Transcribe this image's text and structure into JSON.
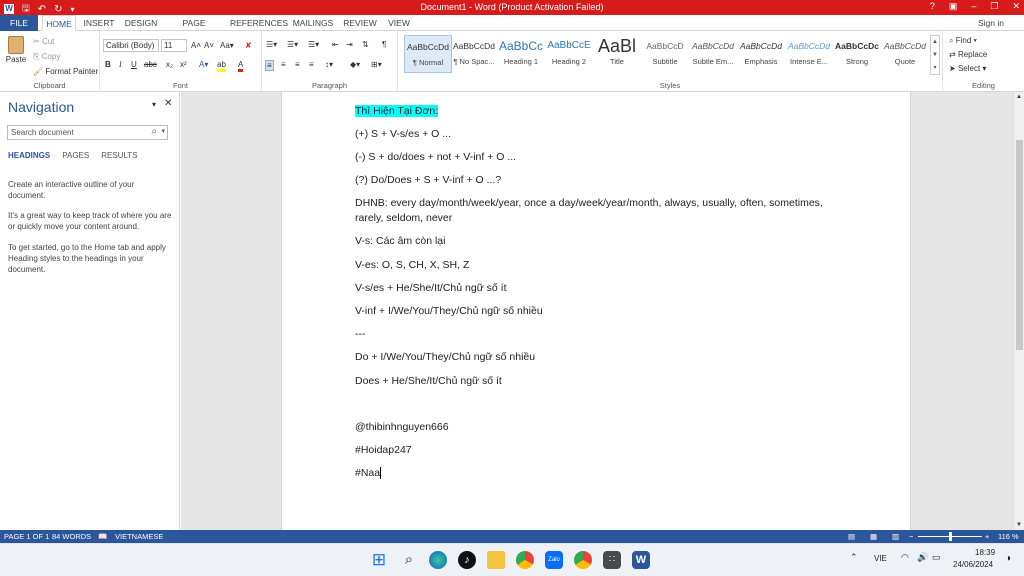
{
  "titlebar": {
    "title": "Document1 - Word (Product Activation Failed)",
    "help": "?"
  },
  "tabs": {
    "file": "FILE",
    "home": "HOME",
    "insert": "INSERT",
    "design": "DESIGN",
    "page_layout": "PAGE LAYOUT",
    "references": "REFERENCES",
    "mailings": "MAILINGS",
    "review": "REVIEW",
    "view": "VIEW",
    "signin": "Sign in"
  },
  "clipboard": {
    "paste": "Paste",
    "cut": "Cut",
    "copy": "Copy",
    "format_painter": "Format Painter",
    "label": "Clipboard"
  },
  "font": {
    "name": "Calibri (Body)",
    "size": "11",
    "label": "Font"
  },
  "paragraph": {
    "label": "Paragraph"
  },
  "styles": {
    "label": "Styles",
    "items": [
      {
        "preview": "AaBbCcDd",
        "name": "¶ Normal"
      },
      {
        "preview": "AaBbCcDd",
        "name": "¶ No Spac..."
      },
      {
        "preview": "AaBbCc",
        "name": "Heading 1"
      },
      {
        "preview": "AaBbCcE",
        "name": "Heading 2"
      },
      {
        "preview": "AaBl",
        "name": "Title"
      },
      {
        "preview": "AaBbCcD",
        "name": "Subtitle"
      },
      {
        "preview": "AaBbCcDd",
        "name": "Subtle Em..."
      },
      {
        "preview": "AaBbCcDd",
        "name": "Emphasis"
      },
      {
        "preview": "AaBbCcDd",
        "name": "Intense E..."
      },
      {
        "preview": "AaBbCcDc",
        "name": "Strong"
      },
      {
        "preview": "AaBbCcDd",
        "name": "Quote"
      }
    ]
  },
  "editing": {
    "find": "Find",
    "replace": "Replace",
    "select": "Select",
    "label": "Editing"
  },
  "navigation": {
    "title": "Navigation",
    "search_placeholder": "Search document",
    "tabs": [
      "HEADINGS",
      "PAGES",
      "RESULTS"
    ],
    "help1": "Create an interactive outline of your document.",
    "help2": "It's a great way to keep track of where you are or quickly move your content around.",
    "help3": "To get started, go to the Home tab and apply Heading styles to the headings in your document."
  },
  "document": {
    "lines": [
      "Thì Hiện Tại Đơn:",
      "(+) S + V-s/es + O ...",
      "(-) S + do/does + not + V-inf + O ...",
      "(?) Do/Does + S + V-inf + O ...?",
      "DHNB: every day/month/week/year, once a day/week/year/month, always, usually, often, sometimes, rarely, seldom, never",
      "V-s: Các âm còn lại",
      "V-es: O, S, CH, X, SH, Z",
      "V-s/es + He/She/It/Chủ ngữ số ít",
      "V-inf + I/We/You/They/Chủ ngữ số nhiều",
      "---",
      "Do + I/We/You/They/Chủ ngữ số nhiều",
      "Does + He/She/It/Chủ ngữ số ít",
      "@thibinhnguyen666",
      "#Hoidap247",
      "#Naa"
    ]
  },
  "status": {
    "page": "PAGE 1 OF 1",
    "words": "84 WORDS",
    "language": "VIETNAMESE",
    "zoom": "116 %"
  },
  "taskbar": {
    "lang": "VIE",
    "time": "18:39",
    "date": "24/06/2024"
  },
  "colors": {
    "accent": "#2b579a",
    "titlebar": "#d71b1b",
    "highlight": "#00ffff"
  }
}
